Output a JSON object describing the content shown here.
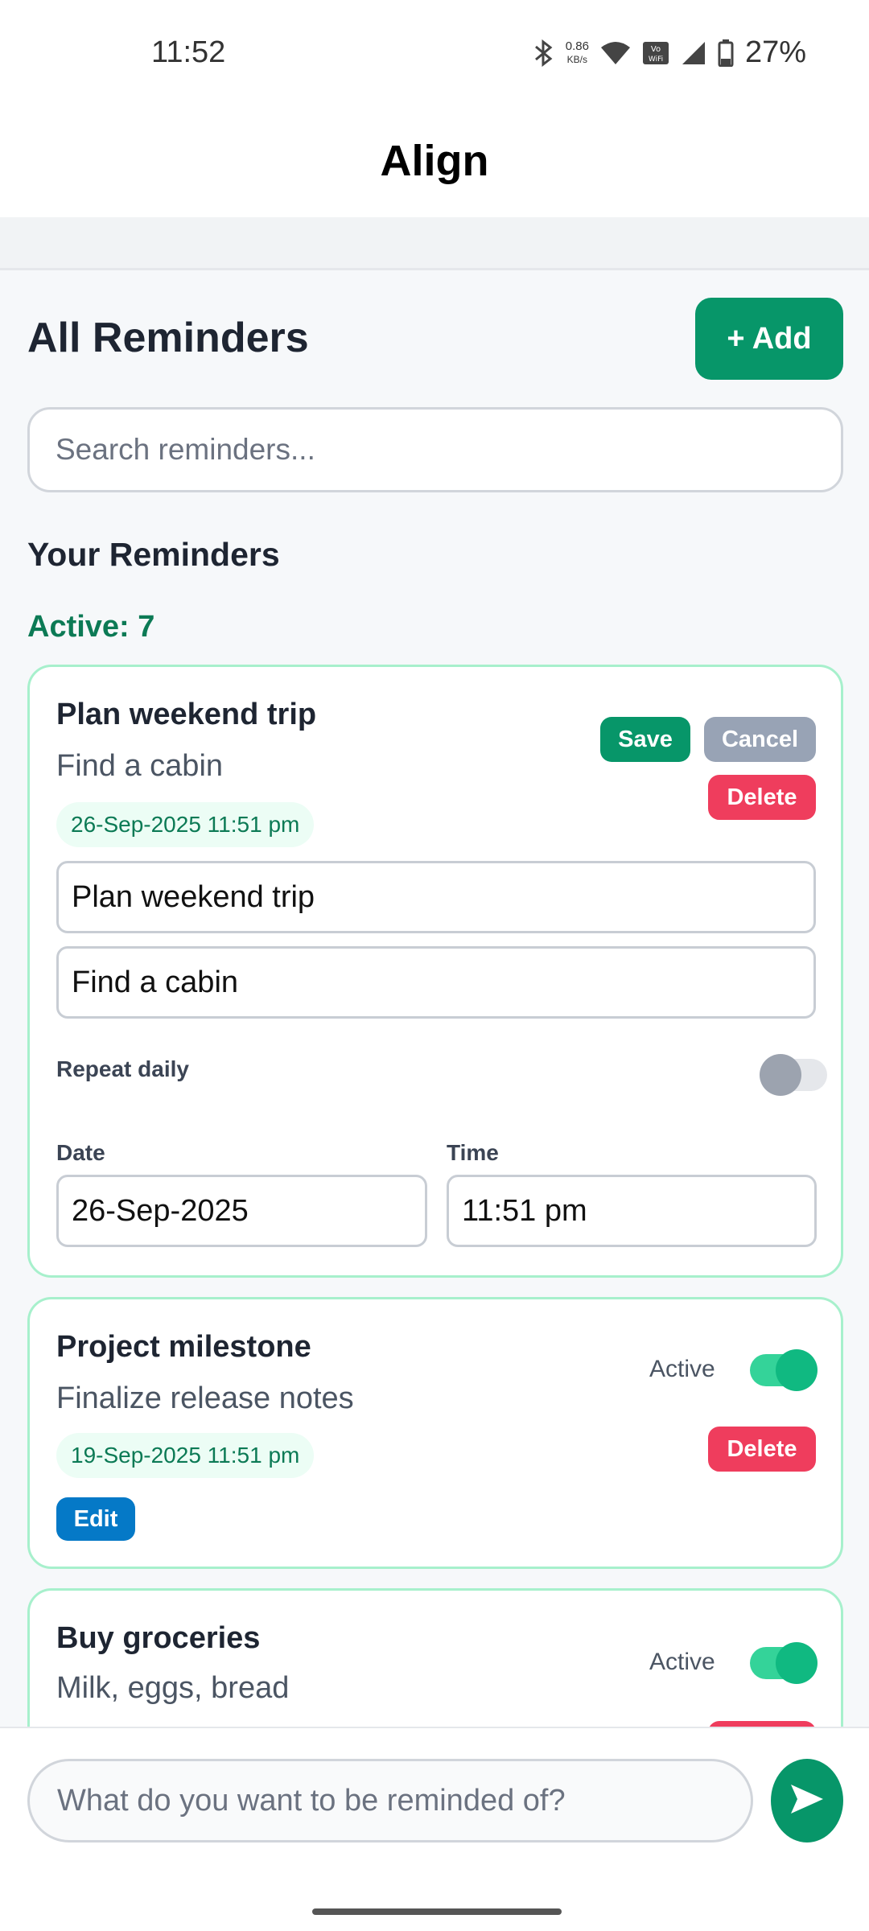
{
  "status": {
    "time": "11:52",
    "net_speed_value": "0.86",
    "net_speed_unit": "KB/s",
    "vowifi": "Vo WiFi",
    "battery": "27%"
  },
  "header": {
    "title": "Align"
  },
  "page": {
    "heading": "All Reminders",
    "add_label": "+ Add",
    "search_placeholder": "Search reminders...",
    "section_title": "Your Reminders",
    "active_count": "Active: 7"
  },
  "reminders": [
    {
      "title": "Plan weekend trip",
      "description": "Find a cabin",
      "datetime": "26-Sep-2025 11:51 pm",
      "editing": true,
      "save_label": "Save",
      "cancel_label": "Cancel",
      "delete_label": "Delete",
      "edit_title_value": "Plan weekend trip",
      "edit_desc_value": "Find a cabin",
      "repeat_label": "Repeat daily",
      "repeat_on": false,
      "date_label": "Date",
      "date_value": "26-Sep-2025",
      "time_label": "Time",
      "time_value": "11:51 pm"
    },
    {
      "title": "Project milestone",
      "description": "Finalize release notes",
      "datetime": "19-Sep-2025 11:51 pm",
      "active_label": "Active",
      "active_on": true,
      "delete_label": "Delete",
      "edit_label": "Edit"
    },
    {
      "title": "Buy groceries",
      "description": "Milk, eggs, bread",
      "active_label": "Active",
      "active_on": true
    }
  ],
  "composer": {
    "placeholder": "What do you want to be reminded of?"
  },
  "icons": {
    "send": "send-icon",
    "bluetooth": "bluetooth-icon",
    "wifi": "wifi-icon",
    "signal": "signal-icon",
    "battery": "battery-icon"
  },
  "colors": {
    "accent": "#079669",
    "danger": "#ef3d5d",
    "edit": "#0579c7",
    "card_border": "#a7f0cc"
  }
}
